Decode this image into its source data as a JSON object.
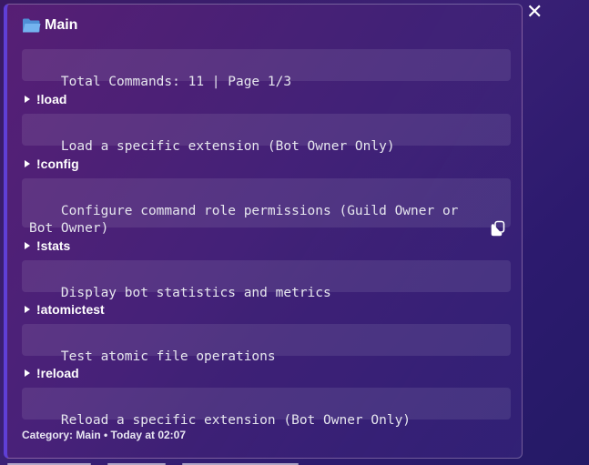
{
  "embed": {
    "title": "Main",
    "title_icon": "folder-icon",
    "accent_color": "#5f3fd6",
    "summary": "Total Commands: 11 | Page 1/3",
    "fields": [
      {
        "name": "!load",
        "value": "Load a specific extension (Bot Owner Only)"
      },
      {
        "name": "!config",
        "value": "Configure command role permissions (Guild Owner or Bot Owner)"
      },
      {
        "name": "!stats",
        "value": "Display bot statistics and metrics"
      },
      {
        "name": "!atomictest",
        "value": "Test atomic file operations"
      },
      {
        "name": "!reload",
        "value": "Reload a specific extension (Bot Owner Only)"
      }
    ],
    "footer": "Category: Main • Today at 02:07"
  },
  "window": {
    "close_icon": "close-icon",
    "close_glyph": "✕"
  }
}
